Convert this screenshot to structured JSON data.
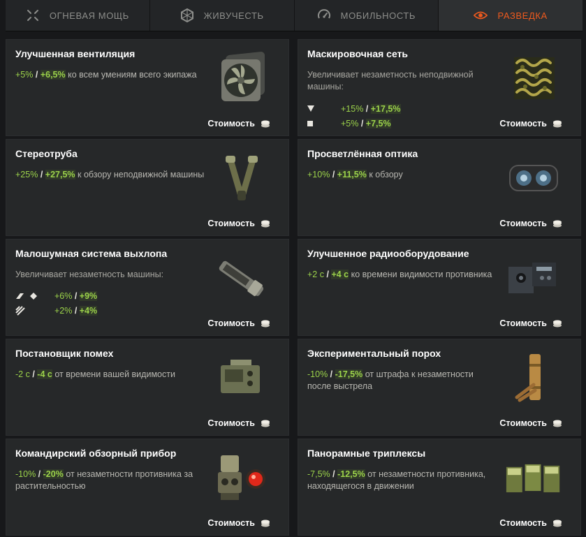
{
  "tabs": [
    {
      "label": "ОГНЕВАЯ МОЩЬ",
      "icon": "crosshair-icon"
    },
    {
      "label": "ЖИВУЧЕСТЬ",
      "icon": "hexagon-armor-icon"
    },
    {
      "label": "МОБИЛЬНОСТЬ",
      "icon": "speedometer-icon"
    },
    {
      "label": "РАЗВЕДКА",
      "icon": "eye-icon",
      "active": true
    }
  ],
  "cost_label": "Стоимость",
  "colors": {
    "accent": "#ef5a1e",
    "bonus": "#9cd34a"
  },
  "cards": [
    {
      "title": "Улучшенная вентиляция",
      "base": "+5%",
      "bonus": "+6,5%",
      "text": "ко всем умениям всего экипажа",
      "image": "ventilation-fan-icon"
    },
    {
      "title": "Маскировочная сеть",
      "text": "Увеличивает незаметность неподвижной машины:",
      "rows": [
        {
          "icon": "triangle-down-icon",
          "base": "+15%",
          "bonus": "+17,5%"
        },
        {
          "icon": "square-icon",
          "base": "+5%",
          "bonus": "+7,5%"
        }
      ],
      "image": "camouflage-net-icon"
    },
    {
      "title": "Стереотруба",
      "base": "+25%",
      "bonus": "+27,5%",
      "text": "к обзору неподвижной машины",
      "image": "stereoscope-icon"
    },
    {
      "title": "Просветлённая оптика",
      "base": "+10%",
      "bonus": "+11,5%",
      "text": "к обзору",
      "image": "coated-optics-icon"
    },
    {
      "title": "Малошумная система выхлопа",
      "text": "Увеличивает незаметность машины:",
      "rows": [
        {
          "icon": "vehicle-class-heavy-medium-icon",
          "base": "+6%",
          "bonus": "+9%"
        },
        {
          "icon": "vehicle-class-td-icon",
          "base": "+2%",
          "bonus": "+4%"
        }
      ],
      "image": "exhaust-system-icon"
    },
    {
      "title": "Улучшенное радиооборудование",
      "base": "+2 с",
      "bonus": "+4 с",
      "text": "ко времени видимости противника",
      "image": "radio-equipment-icon"
    },
    {
      "title": "Постановщик помех",
      "base": "-2 с",
      "bonus": "-4 с",
      "text": "от времени вашей видимости",
      "image": "jammer-icon"
    },
    {
      "title": "Экспериментальный порох",
      "base": "-10%",
      "bonus": "-17,5%",
      "text": "от штрафа к незаметности после выстрела",
      "image": "powder-charges-icon"
    },
    {
      "title": "Командирский обзорный прибор",
      "base": "-10%",
      "bonus": "-20%",
      "text": "от незаметности противника за растительностью",
      "image": "commander-sight-icon"
    },
    {
      "title": "Панорамные триплексы",
      "base": "-7,5%",
      "bonus": "-12,5%",
      "text": "от незаметности противника, находящегося в движении",
      "image": "triplex-blocks-icon"
    }
  ]
}
